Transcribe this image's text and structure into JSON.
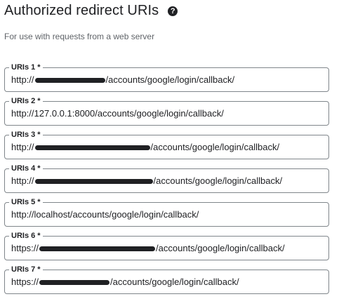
{
  "header": {
    "title": "Authorized redirect URIs",
    "help_icon": "help-circle-icon",
    "subtitle": "For use with requests from a web server"
  },
  "uris": [
    {
      "label": "URIs 1 *",
      "prefix": "http://",
      "redacted": true,
      "suffix": "/accounts/google/login/callback/"
    },
    {
      "label": "URIs 2 *",
      "prefix": "http://127.0.0.1:8000/accounts/google/login/callback/",
      "redacted": false,
      "suffix": ""
    },
    {
      "label": "URIs 3 *",
      "prefix": "http://",
      "redacted": true,
      "suffix": "/accounts/google/login/callback/"
    },
    {
      "label": "URIs 4 *",
      "prefix": "http://",
      "redacted": true,
      "suffix": "/accounts/google/login/callback/"
    },
    {
      "label": "URIs 5 *",
      "prefix": "http://localhost/accounts/google/login/callback/",
      "redacted": false,
      "suffix": ""
    },
    {
      "label": "URIs 6 *",
      "prefix": "https://",
      "redacted": true,
      "suffix": "/accounts/google/login/callback/"
    },
    {
      "label": "URIs 7 *",
      "prefix": "https://",
      "redacted": true,
      "suffix": "/accounts/google/login/callback/"
    }
  ]
}
